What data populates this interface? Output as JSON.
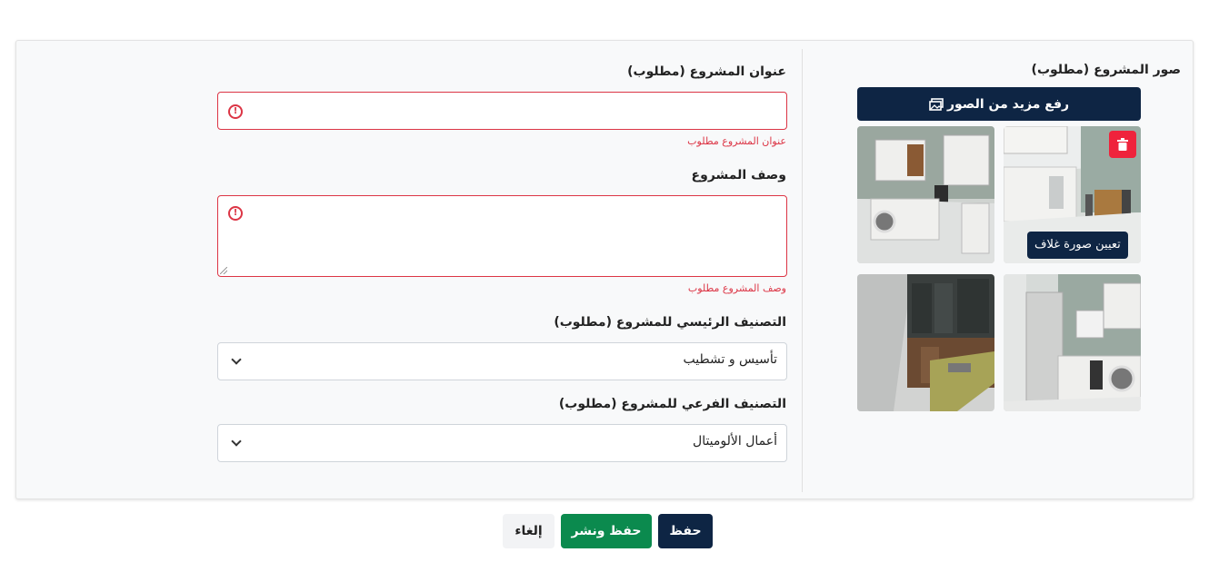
{
  "form": {
    "title_label": "عنوان المشروع (مطلوب)",
    "title_value": "",
    "title_error": "عنوان المشروع مطلوب",
    "description_label": "وصف المشروع",
    "description_value": "",
    "description_error": "وصف المشروع مطلوب",
    "main_category_label": "التصنيف الرئيسي للمشروع (مطلوب)",
    "main_category_value": "تأسيس و تشطيب",
    "sub_category_label": "التصنيف الفرعي للمشروع (مطلوب)",
    "sub_category_value": "أعمال الألوميتال"
  },
  "photos": {
    "label": "صور المشروع (مطلوب)",
    "upload_label": "رفع مزيد من الصور",
    "set_cover_label": "تعيين صورة غلاف",
    "items": [
      "kitchen-photo-1",
      "kitchen-photo-2",
      "kitchen-photo-3",
      "kitchen-photo-4"
    ]
  },
  "actions": {
    "save_label": "حفظ",
    "save_publish_label": "حفظ ونشر",
    "cancel_label": "إلغاء"
  },
  "colors": {
    "primary": "#0e2544",
    "success": "#0b8a4e",
    "danger": "#dc3545",
    "delete": "#ef233c"
  }
}
